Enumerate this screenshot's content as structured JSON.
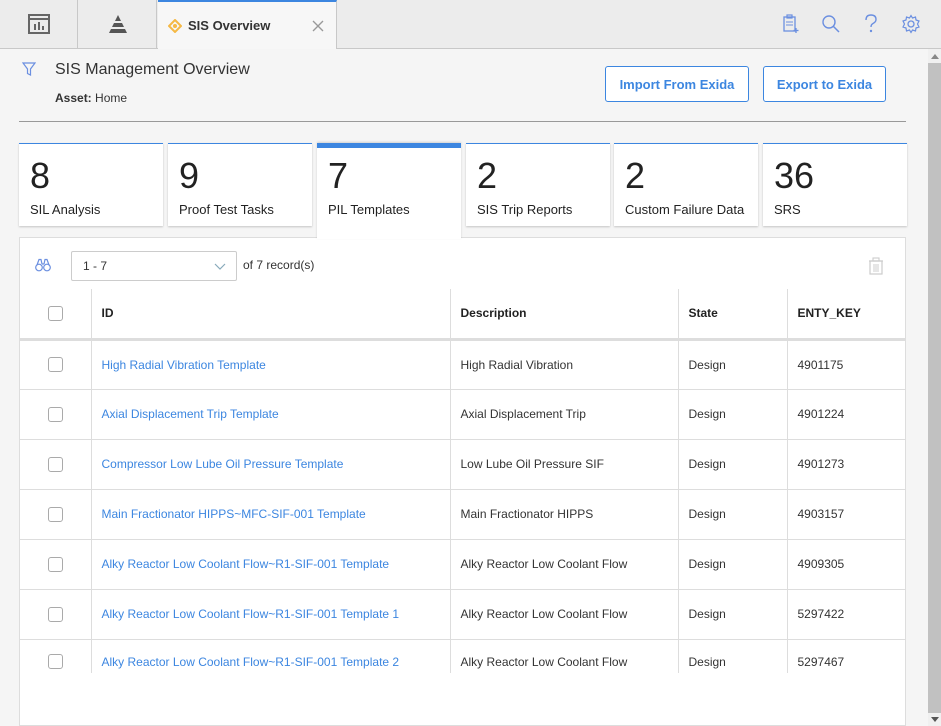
{
  "topbar": {
    "nav_icons": [
      "dashboard-icon",
      "pyramid-icon"
    ],
    "active_tab": {
      "label": "SIS Overview",
      "icon": "diamond-icon",
      "close_icon": "close-icon"
    },
    "tools": [
      "clipboard-add-icon",
      "search-icon",
      "help-icon",
      "gear-icon"
    ]
  },
  "header": {
    "title": "SIS Management Overview",
    "asset_label": "Asset:",
    "asset_value": "Home",
    "import_button": "Import From Exida",
    "export_button": "Export to Exida"
  },
  "cards": [
    {
      "count": "8",
      "label": "SIL Analysis",
      "active": false
    },
    {
      "count": "9",
      "label": "Proof Test Tasks",
      "active": false
    },
    {
      "count": "7",
      "label": "PIL Templates",
      "active": true
    },
    {
      "count": "2",
      "label": "SIS Trip Reports",
      "active": false
    },
    {
      "count": "2",
      "label": "Custom Failure Data",
      "active": false
    },
    {
      "count": "36",
      "label": "SRS",
      "active": false
    }
  ],
  "grid": {
    "range": "1 - 7",
    "of_label": "of",
    "total": "7",
    "records_label": "record(s)",
    "columns": [
      "ID",
      "Description",
      "State",
      "ENTY_KEY"
    ],
    "rows": [
      {
        "id": "High Radial Vibration Template",
        "description": "High Radial Vibration",
        "state": "Design",
        "key": "4901175"
      },
      {
        "id": "Axial Displacement Trip Template",
        "description": "Axial Displacement Trip",
        "state": "Design",
        "key": "4901224"
      },
      {
        "id": "Compressor Low Lube Oil Pressure Template",
        "description": "Low Lube Oil Pressure SIF",
        "state": "Design",
        "key": "4901273"
      },
      {
        "id": "Main Fractionator HIPPS~MFC-SIF-001 Template",
        "description": "Main Fractionator HIPPS",
        "state": "Design",
        "key": "4903157"
      },
      {
        "id": "Alky Reactor Low Coolant Flow~R1-SIF-001 Template",
        "description": "Alky Reactor Low Coolant Flow",
        "state": "Design",
        "key": "4909305"
      },
      {
        "id": "Alky Reactor Low Coolant Flow~R1-SIF-001 Template 1",
        "description": "Alky Reactor Low Coolant Flow",
        "state": "Design",
        "key": "5297422"
      },
      {
        "id": "Alky Reactor Low Coolant Flow~R1-SIF-001 Template 2",
        "description": "Alky Reactor Low Coolant Flow",
        "state": "Design",
        "key": "5297467"
      }
    ]
  },
  "colors": {
    "accent": "#3c86e0",
    "tab_icon": "#f5b945"
  }
}
